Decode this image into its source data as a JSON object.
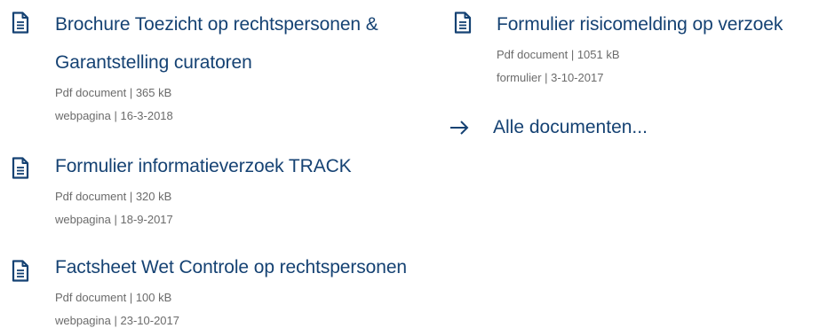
{
  "documents_left": [
    {
      "title_line1": "Brochure Toezicht op rechtspersonen &",
      "title_line2": "Garantstelling curatoren",
      "meta1": "Pdf document | 365 kB",
      "meta2": "webpagina | 16-3-2018",
      "icon": "document-icon"
    },
    {
      "title_line1": "Formulier informatieverzoek TRACK",
      "meta1": "Pdf document | 320 kB",
      "meta2": "webpagina | 18-9-2017",
      "icon": "document-icon"
    },
    {
      "title_line1": "Factsheet Wet Controle op rechtspersonen",
      "meta1": "Pdf document | 100 kB",
      "meta2": "webpagina | 23-10-2017",
      "icon": "document-icon"
    }
  ],
  "documents_right": [
    {
      "title_line1": "Formulier risicomelding op verzoek",
      "meta1": "Pdf document | 1051 kB",
      "meta2": "formulier | 3-10-2017",
      "icon": "document-icon"
    }
  ],
  "all_documents": {
    "label": "Alle documenten...",
    "icon": "arrow-right-icon"
  },
  "colors": {
    "link": "#154273",
    "meta": "#6b6b6b"
  }
}
